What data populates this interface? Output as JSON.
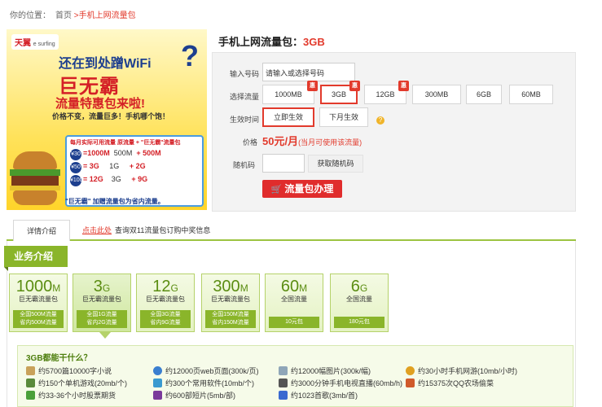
{
  "breadcrumb": {
    "prefix": "你的位置：",
    "home": "首页",
    "current": ">手机上网流量包"
  },
  "banner": {
    "logo": "天翼",
    "logo_sub": "e surfing",
    "line1": "还在到处蹭WiFi",
    "q": "?",
    "line2": "巨无霸",
    "line3": "流量特惠包来啦!",
    "line4": "价格不变，流量巨多！手机哪个饱！",
    "table_head": "每月实际可用流量   原流量  + \"巨无霸\"流量包",
    "rows": [
      {
        "price": "¥30",
        "flow": "=1000M",
        "base": "500M",
        "extra": "+ 500M"
      },
      {
        "price": "¥50",
        "flow": "= 3G",
        "base": "1G",
        "extra": "+ 2G"
      },
      {
        "price": "¥100",
        "flow": "= 12G",
        "base": "3G",
        "extra": "+ 9G"
      }
    ],
    "footer": "\"巨无霸\" 加赠流量包为省内流量。"
  },
  "product": {
    "title": "手机上网流量包：",
    "size": "3GB"
  },
  "form": {
    "phone_label": "输入号码",
    "phone_value": "请输入或选择号码",
    "flow_label": "选择流量",
    "flow_options": [
      "1000MB",
      "3GB",
      "12GB",
      "300MB",
      "6GB",
      "60MB"
    ],
    "hui_badge": "惠",
    "effect_label": "生效时间",
    "effect_options": [
      "立即生效",
      "下月生效"
    ],
    "help": "?",
    "price_label": "价格",
    "price": "50元/月",
    "price_note": "(当月可使用该流量)",
    "captcha_label": "随机码",
    "captcha_button": "获取随机码",
    "order_button": "流量包办理",
    "cart_icon": "🛒"
  },
  "tabs": {
    "active": "详情介绍",
    "link": "点击此处",
    "note": "查询双11流量包订购中奖信息"
  },
  "intro": {
    "header": "业务介绍",
    "cards": [
      {
        "big": "1000",
        "unit": "M",
        "sub": "巨无霸流量包",
        "bar1": "全国500M流量",
        "bar2": "省内500M流量"
      },
      {
        "big": "3",
        "unit": "G",
        "sub": "巨无霸流量包",
        "bar1": "全国1G流量",
        "bar2": "省内2G流量"
      },
      {
        "big": "12",
        "unit": "G",
        "sub": "巨无霸流量包",
        "bar1": "全国3G流量",
        "bar2": "省内9G流量"
      },
      {
        "big": "300",
        "unit": "M",
        "sub": "巨无霸流量包",
        "bar1": "全国150M流量",
        "bar2": "省内150M流量"
      },
      {
        "big": "60",
        "unit": "M",
        "sub": "全国流量",
        "bar1": "10元包",
        "bar2": ""
      },
      {
        "big": "6",
        "unit": "G",
        "sub": "全国流量",
        "bar1": "180元包",
        "bar2": ""
      }
    ],
    "question": "3GB都能干什么？",
    "uses": [
      {
        "text": "约5700篇10000字小说",
        "color": "#c9a25a"
      },
      {
        "text": "约12000页web页面(300k/页)",
        "color": "#3a7fd0"
      },
      {
        "text": "约12000幅图片(300k/幅)",
        "color": "#8fa6b8"
      },
      {
        "text": "约30小时手机网游(10mb/小时)",
        "color": "#e0a020"
      },
      {
        "text": "约150个单机游戏(20mb/个)",
        "color": "#5a8a3a"
      },
      {
        "text": "约300个常用软件(10mb/个)",
        "color": "#3a9ad0"
      },
      {
        "text": "约3000分钟手机电视直播(60mb/h)",
        "color": "#555555"
      },
      {
        "text": "约15375次QQ农场偷菜",
        "color": "#d05a2a"
      },
      {
        "text": "约33-36个小时股票期货",
        "color": "#4aa03a"
      },
      {
        "text": "约600部短片(5mb/部)",
        "color": "#7a3a9a"
      },
      {
        "text": "约1023首歌(3mb/首)",
        "color": "#3a6ad0"
      }
    ]
  }
}
